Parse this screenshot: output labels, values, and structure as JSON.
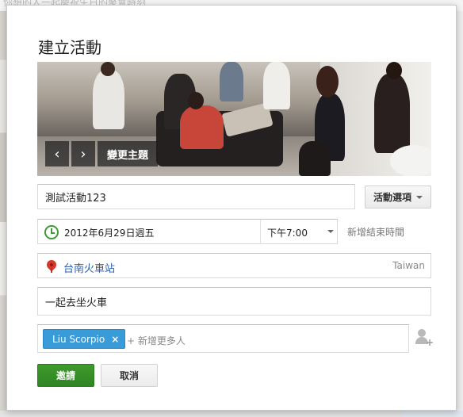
{
  "background": {
    "top_text": "你想的人一起慶祝生日的聚會時刻"
  },
  "dialog": {
    "title": "建立活動"
  },
  "banner": {
    "prev_icon": "chevron-left-icon",
    "next_icon": "chevron-right-icon",
    "change_theme_label": "變更主題"
  },
  "event": {
    "name_value": "測試活動123",
    "options_label": "活動選項",
    "date": "2012年6月29日週五",
    "time": "下午7:00",
    "add_end_time": "新增結束時間",
    "location": "台南火車站",
    "location_country": "Taiwan",
    "description": "一起去坐火車"
  },
  "invite": {
    "guest_chip": "Liu Scorpio",
    "remove_symbol": "×",
    "add_more_placeholder": "+ 新增更多人"
  },
  "actions": {
    "invite_label": "邀請",
    "cancel_label": "取消"
  },
  "colors": {
    "primary_green": "#3d9a36",
    "chip_blue": "#3a9bd9",
    "link_blue": "#2a5db0",
    "pin_red": "#d9362b"
  }
}
